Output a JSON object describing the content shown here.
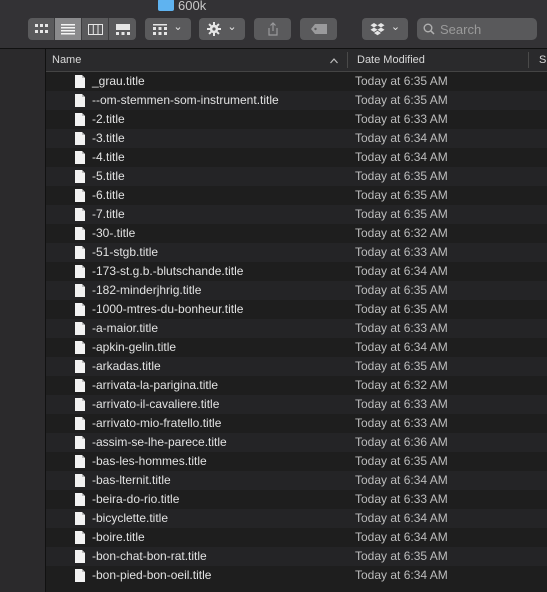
{
  "window": {
    "title": "600k"
  },
  "toolbar": {
    "view_icon": "icon-view-icon",
    "view_list": "list-view-icon",
    "view_columns": "column-view-icon",
    "view_gallery": "gallery-view-icon",
    "arrange_chevron": "⌄",
    "action_chevron": "⌄",
    "dropbox_chevron": "⌄"
  },
  "search": {
    "placeholder": "Search",
    "value": ""
  },
  "header": {
    "name": "Name",
    "date_modified": "Date Modified",
    "size_partial": "S",
    "sort_indicator": "^"
  },
  "files": [
    {
      "name": "_grau.title",
      "date": "Today at 6:35 AM"
    },
    {
      "name": "--om-stemmen-som-instrument.title",
      "date": "Today at 6:35 AM"
    },
    {
      "name": "-2.title",
      "date": "Today at 6:33 AM"
    },
    {
      "name": "-3.title",
      "date": "Today at 6:34 AM"
    },
    {
      "name": "-4.title",
      "date": "Today at 6:34 AM"
    },
    {
      "name": "-5.title",
      "date": "Today at 6:35 AM"
    },
    {
      "name": "-6.title",
      "date": "Today at 6:35 AM"
    },
    {
      "name": "-7.title",
      "date": "Today at 6:35 AM"
    },
    {
      "name": "-30-.title",
      "date": "Today at 6:32 AM"
    },
    {
      "name": "-51-stgb.title",
      "date": "Today at 6:33 AM"
    },
    {
      "name": "-173-st.g.b.-blutschande.title",
      "date": "Today at 6:34 AM"
    },
    {
      "name": "-182-minderjhrig.title",
      "date": "Today at 6:35 AM"
    },
    {
      "name": "-1000-mtres-du-bonheur.title",
      "date": "Today at 6:35 AM"
    },
    {
      "name": "-a-maior.title",
      "date": "Today at 6:33 AM"
    },
    {
      "name": "-apkin-gelin.title",
      "date": "Today at 6:34 AM"
    },
    {
      "name": "-arkadas.title",
      "date": "Today at 6:35 AM"
    },
    {
      "name": "-arrivata-la-parigina.title",
      "date": "Today at 6:32 AM"
    },
    {
      "name": "-arrivato-il-cavaliere.title",
      "date": "Today at 6:33 AM"
    },
    {
      "name": "-arrivato-mio-fratello.title",
      "date": "Today at 6:33 AM"
    },
    {
      "name": "-assim-se-lhe-parece.title",
      "date": "Today at 6:36 AM"
    },
    {
      "name": "-bas-les-hommes.title",
      "date": "Today at 6:35 AM"
    },
    {
      "name": "-bas-lternit.title",
      "date": "Today at 6:34 AM"
    },
    {
      "name": "-beira-do-rio.title",
      "date": "Today at 6:33 AM"
    },
    {
      "name": "-bicyclette.title",
      "date": "Today at 6:34 AM"
    },
    {
      "name": "-boire.title",
      "date": "Today at 6:34 AM"
    },
    {
      "name": "-bon-chat-bon-rat.title",
      "date": "Today at 6:35 AM"
    },
    {
      "name": "-bon-pied-bon-oeil.title",
      "date": "Today at 6:34 AM"
    }
  ]
}
